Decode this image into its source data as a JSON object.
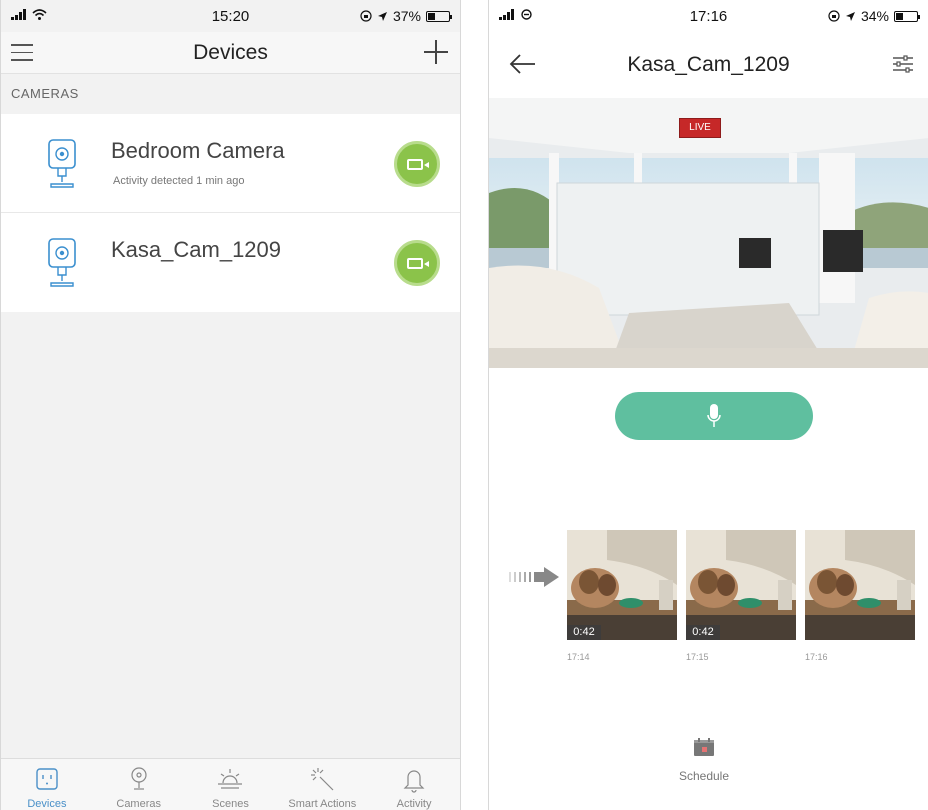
{
  "left_phone": {
    "status_bar": {
      "time": "15:20",
      "battery": "37%",
      "battery_level": 0.37
    },
    "nav": {
      "title": "Devices"
    },
    "section_label": "CAMERAS",
    "devices": [
      {
        "name": "Bedroom Camera",
        "status": "Activity detected 1 min ago"
      },
      {
        "name": "Kasa_Cam_1209",
        "status": ""
      }
    ],
    "tabs": [
      {
        "label": "Devices",
        "icon": "outlet-icon",
        "active": true
      },
      {
        "label": "Cameras",
        "icon": "camera-icon",
        "active": false
      },
      {
        "label": "Scenes",
        "icon": "sunrise-icon",
        "active": false
      },
      {
        "label": "Smart Actions",
        "icon": "magic-wand-icon",
        "active": false
      },
      {
        "label": "Activity",
        "icon": "bell-icon",
        "active": false
      }
    ]
  },
  "right_phone": {
    "status_bar": {
      "time": "17:16",
      "battery": "34%",
      "battery_level": 0.34
    },
    "nav": {
      "title": "Kasa_Cam_1209"
    },
    "live_badge": "LIVE",
    "clips": [
      {
        "duration": "0:42",
        "time": "17:14"
      },
      {
        "duration": "0:42",
        "time": "17:15"
      },
      {
        "duration": "",
        "time": "17:16"
      }
    ],
    "schedule_label": "Schedule"
  },
  "colors": {
    "accent_green": "#8bc34a",
    "mic_teal": "#5fbf9f",
    "live_red": "#c62828",
    "tab_active_blue": "#4a90c8"
  }
}
